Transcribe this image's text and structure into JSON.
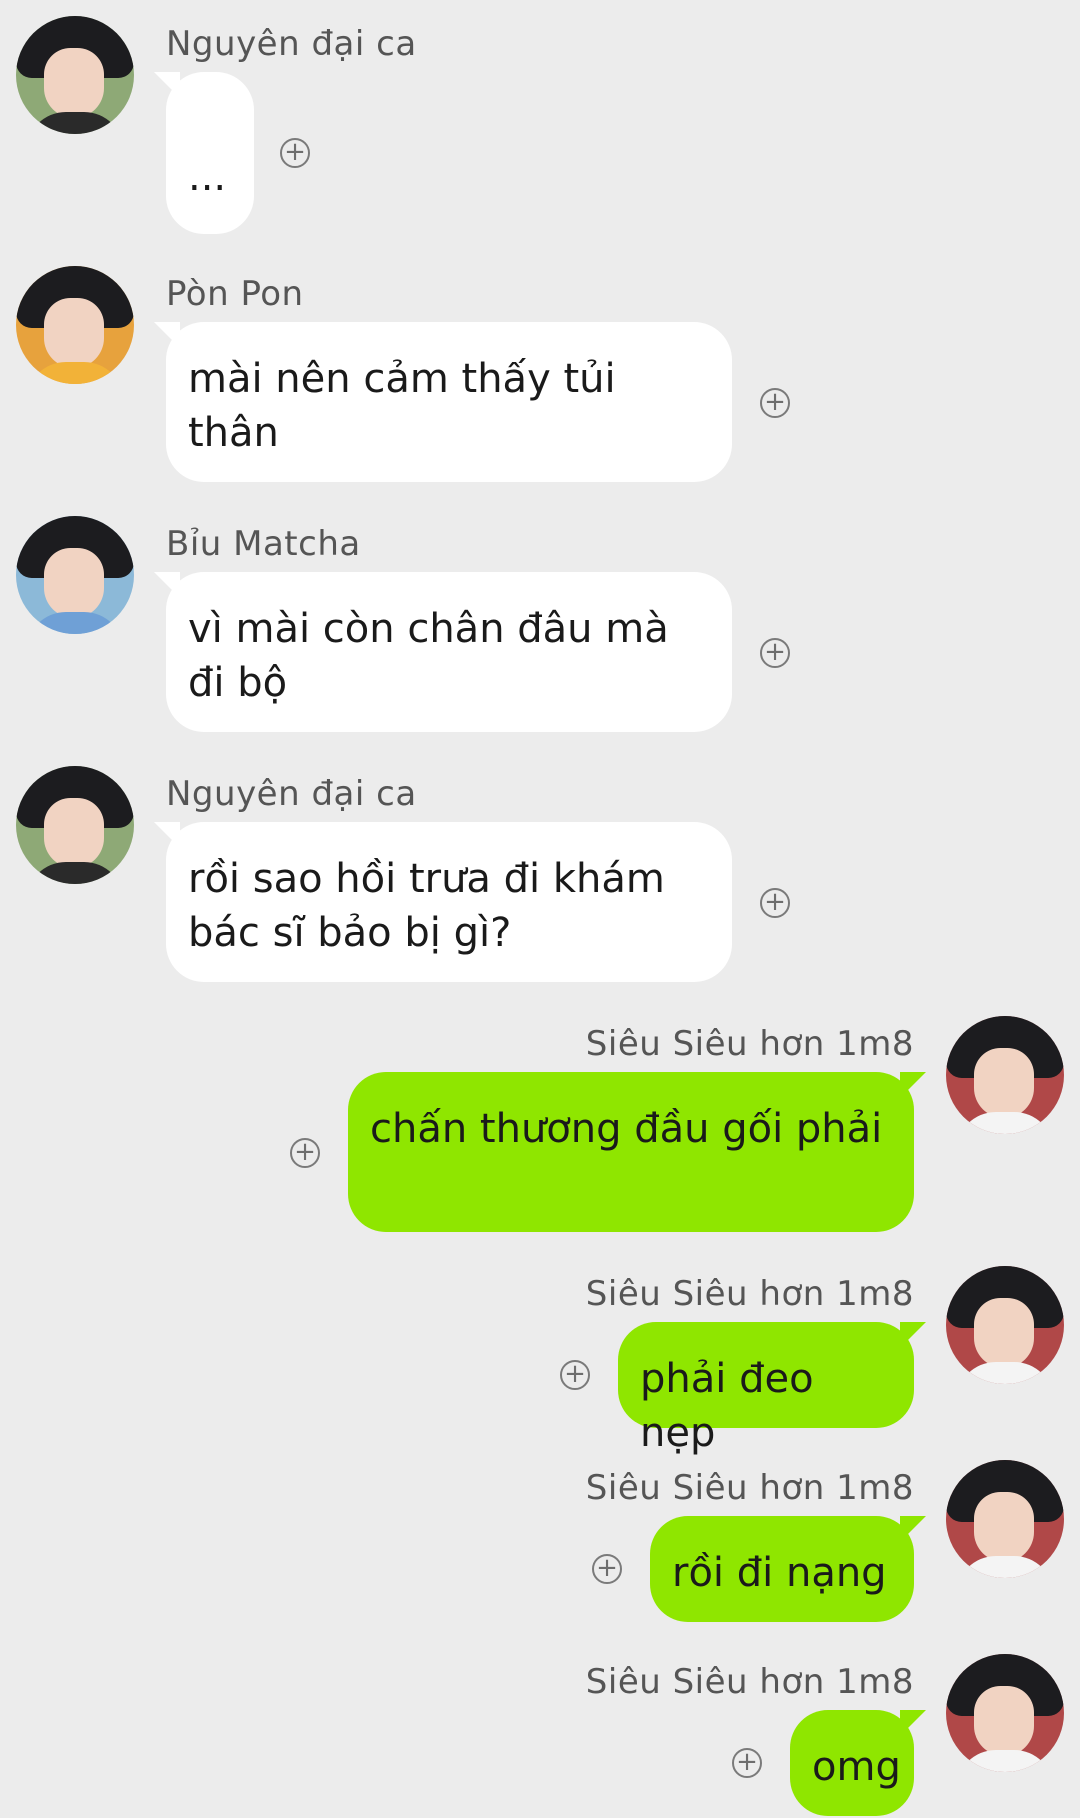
{
  "messages": [
    {
      "sender": "Nguyên đại ca",
      "text": "...",
      "side": "left",
      "avatar": "person-avatar"
    },
    {
      "sender": "Pòn Pon",
      "text": "mài nên cảm thấy tủi thân",
      "side": "left",
      "avatar": "person-avatar"
    },
    {
      "sender": "Bỉu Matcha",
      "text": "vì mài còn chân đâu mà đi bộ",
      "side": "left",
      "avatar": "person-avatar"
    },
    {
      "sender": "Nguyên đại ca",
      "text": "rồi sao hồi trưa đi khám bác sĩ bảo bị gì?",
      "side": "left",
      "avatar": "person-avatar"
    },
    {
      "sender": "Siêu Siêu hơn 1m8",
      "text": "chấn thương đầu gối phải",
      "side": "right",
      "avatar": "person-avatar"
    },
    {
      "sender": "Siêu Siêu hơn 1m8",
      "text": "phải đeo nẹp",
      "side": "right",
      "avatar": "person-avatar"
    },
    {
      "sender": "Siêu Siêu hơn 1m8",
      "text": "rồi đi nạng",
      "side": "right",
      "avatar": "person-avatar"
    },
    {
      "sender": "Siêu Siêu hơn 1m8",
      "text": "omg",
      "side": "right",
      "avatar": "person-avatar"
    }
  ],
  "icons": {
    "react": "+"
  },
  "colors": {
    "background": "#ececec",
    "incoming_bubble": "#ffffff",
    "outgoing_bubble": "#8fe600"
  }
}
